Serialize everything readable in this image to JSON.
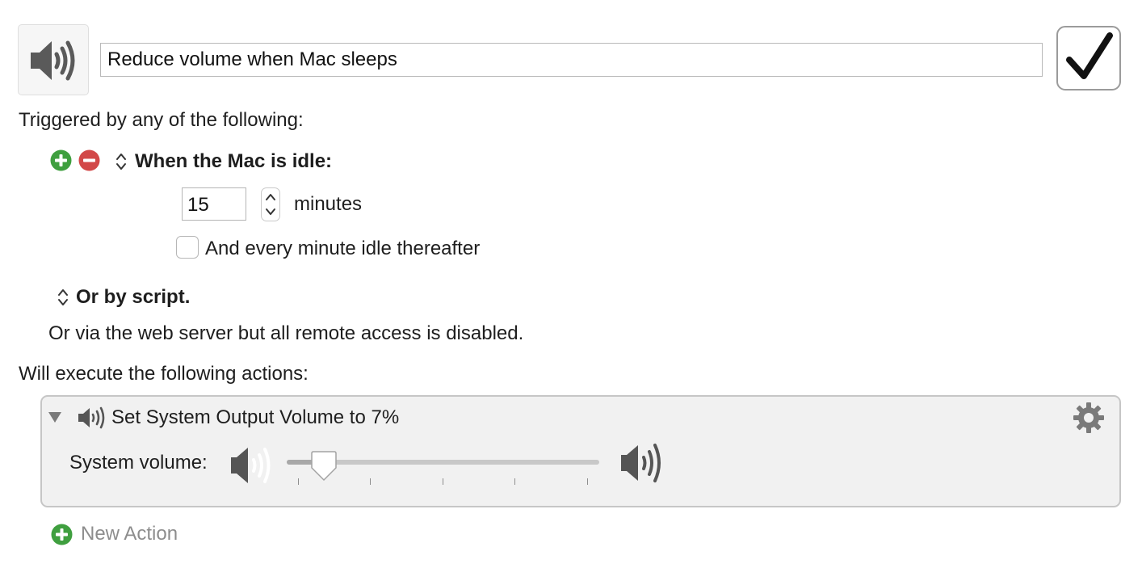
{
  "macro": {
    "icon": "speaker-volume-icon",
    "name": "Reduce volume when Mac sleeps",
    "enabled": true
  },
  "triggers": {
    "heading": "Triggered by any of the following:",
    "idle_trigger": {
      "title": "When the Mac is idle:",
      "minutes_value": "15",
      "minutes_label": "minutes",
      "repeat_label": "And every minute idle thereafter",
      "repeat_checked": false
    },
    "script_trigger": {
      "title": "Or by script."
    },
    "web_server_note": "Or via the web server but all remote access is disabled."
  },
  "actions": {
    "heading": "Will execute the following actions:",
    "items": [
      {
        "title": "Set System Output Volume to 7%",
        "icon": "speaker-volume-icon",
        "volume_label": "System volume:",
        "volume_fraction": 0.07,
        "expanded": true
      }
    ],
    "new_action_label": "New Action"
  },
  "colors": {
    "add_green": "#3f9f3f",
    "remove_red": "#d24848",
    "panel_bg": "#f1f1f1",
    "text": "#1e1e1e",
    "muted": "#8d8d8d"
  }
}
